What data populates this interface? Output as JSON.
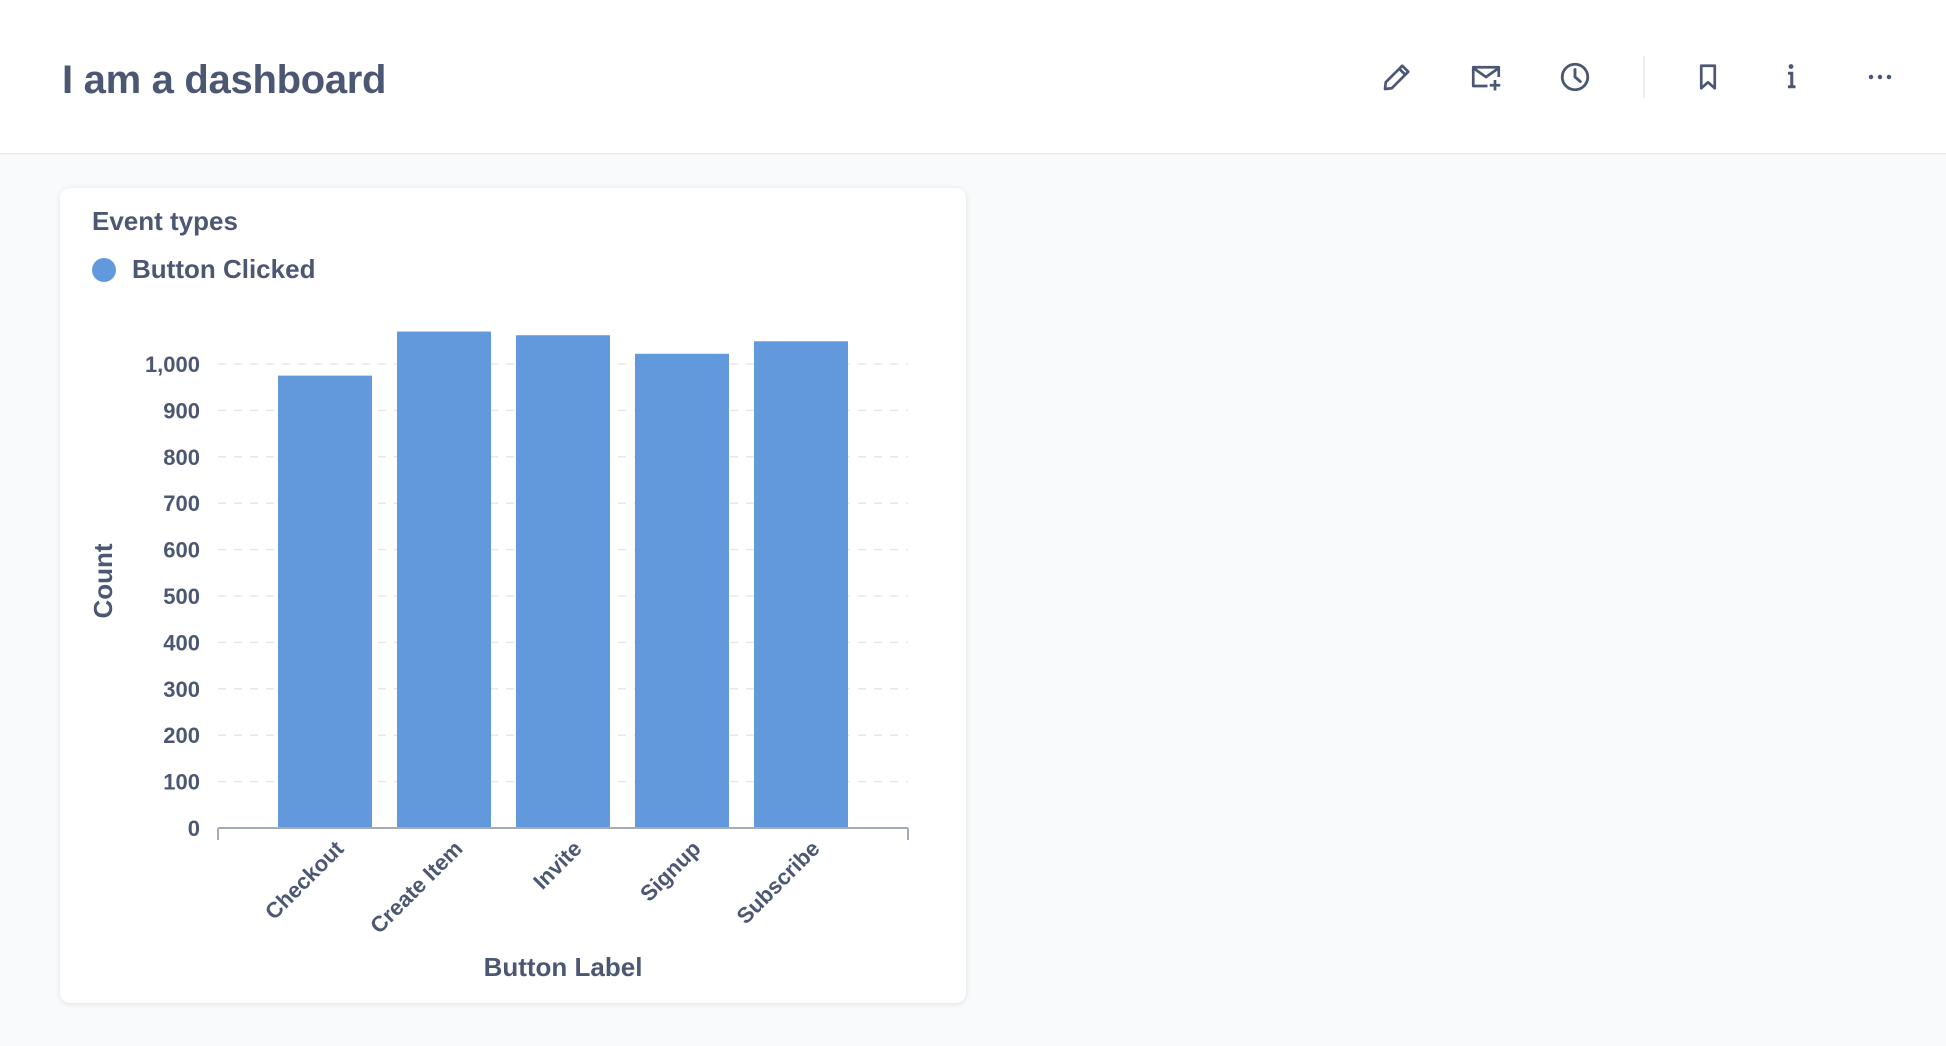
{
  "header": {
    "title": "I am a dashboard",
    "actions": [
      {
        "icon": "pencil-icon",
        "name": "edit-button"
      },
      {
        "icon": "mail-add-icon",
        "name": "subscribe-button"
      },
      {
        "icon": "clock-icon",
        "name": "history-button"
      },
      {
        "icon": "bookmark-icon",
        "name": "bookmark-button"
      },
      {
        "icon": "info-icon",
        "name": "info-button"
      },
      {
        "icon": "more-icon",
        "name": "more-button"
      }
    ]
  },
  "card": {
    "title": "Event types",
    "legend": {
      "label": "Button Clicked",
      "color": "#6299dc"
    }
  },
  "colors": {
    "bar": "#6299dc",
    "text": "#4c5773",
    "gridline": "#e6e8ec",
    "axis": "#a5abb8"
  },
  "chart_data": {
    "type": "bar",
    "categories": [
      "Checkout",
      "Create Item",
      "Invite",
      "Signup",
      "Subscribe"
    ],
    "series": [
      {
        "name": "Button Clicked",
        "values": [
          975,
          1070,
          1062,
          1022,
          1049
        ]
      }
    ],
    "xlabel": "Button Label",
    "ylabel": "Count",
    "ylim": [
      0,
      1000
    ],
    "yticks": [
      0,
      100,
      200,
      300,
      400,
      500,
      600,
      700,
      800,
      900,
      1000
    ],
    "ytick_labels": [
      "0",
      "100",
      "200",
      "300",
      "400",
      "500",
      "600",
      "700",
      "800",
      "900",
      "1,000"
    ],
    "grid": true,
    "legend": "top-left"
  }
}
